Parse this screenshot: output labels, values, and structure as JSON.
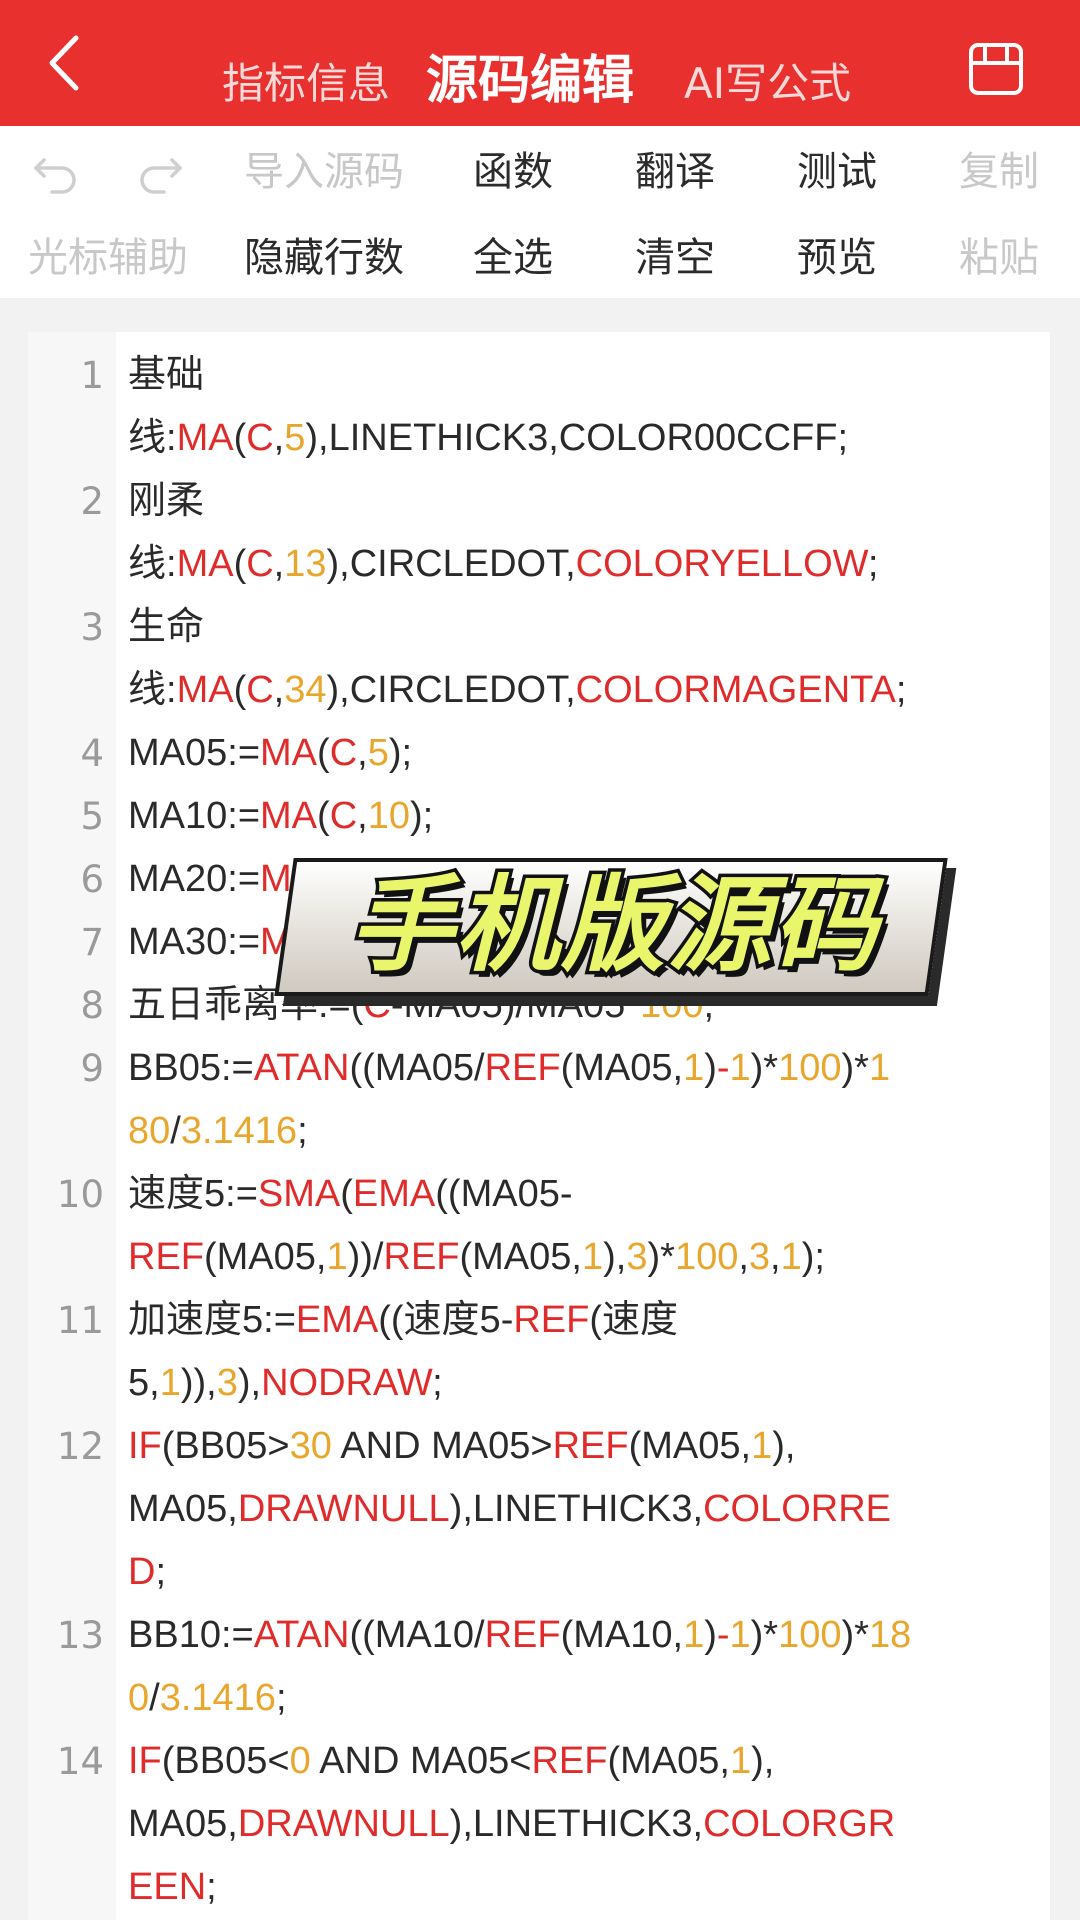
{
  "header": {
    "tabs": [
      {
        "label": "指标信息",
        "active": false
      },
      {
        "label": "源码编辑",
        "active": true
      },
      {
        "label": "AI写公式",
        "active": false
      }
    ],
    "back_icon": "chevron-left-icon",
    "save_icon": "save-icon",
    "color": "#e8312f"
  },
  "toolbar": {
    "row1": [
      {
        "icon": "undo-icon",
        "enabled": false
      },
      {
        "icon": "redo-icon",
        "enabled": false
      },
      {
        "label": "导入源码",
        "enabled": false
      },
      {
        "label": "函数",
        "enabled": true
      },
      {
        "label": "翻译",
        "enabled": true
      },
      {
        "label": "测试",
        "enabled": true
      },
      {
        "label": "复制",
        "enabled": false
      }
    ],
    "row2": [
      {
        "label": "光标辅助",
        "enabled": false
      },
      {
        "label": "隐藏行数",
        "enabled": true
      },
      {
        "label": "全选",
        "enabled": true
      },
      {
        "label": "清空",
        "enabled": true
      },
      {
        "label": "预览",
        "enabled": true
      },
      {
        "label": "粘贴",
        "enabled": false
      }
    ]
  },
  "colors": {
    "keyword": "#e02b2b",
    "number": "#e8a62c",
    "text": "#2a2a2a"
  },
  "code_lines": [
    {
      "num": "1",
      "rows": [
        [
          [
            "t",
            "基础"
          ]
        ],
        [
          [
            "t",
            "线:"
          ],
          [
            "k",
            "MA"
          ],
          [
            "t",
            "("
          ],
          [
            "k",
            "C"
          ],
          [
            "t",
            ","
          ],
          [
            "n",
            "5"
          ],
          [
            "t",
            "),LINETHICK3,COLOR00CCFF;"
          ]
        ]
      ]
    },
    {
      "num": "2",
      "rows": [
        [
          [
            "t",
            "刚柔"
          ]
        ],
        [
          [
            "t",
            "线:"
          ],
          [
            "k",
            "MA"
          ],
          [
            "t",
            "("
          ],
          [
            "k",
            "C"
          ],
          [
            "t",
            ","
          ],
          [
            "n",
            "13"
          ],
          [
            "t",
            "),CIRCLEDOT,"
          ],
          [
            "k",
            "COLORYELLOW"
          ],
          [
            "t",
            ";"
          ]
        ]
      ]
    },
    {
      "num": "3",
      "rows": [
        [
          [
            "t",
            "生命"
          ]
        ],
        [
          [
            "t",
            "线:"
          ],
          [
            "k",
            "MA"
          ],
          [
            "t",
            "("
          ],
          [
            "k",
            "C"
          ],
          [
            "t",
            ","
          ],
          [
            "n",
            "34"
          ],
          [
            "t",
            "),CIRCLEDOT,"
          ],
          [
            "k",
            "COLORMAGENTA"
          ],
          [
            "t",
            ";"
          ]
        ]
      ]
    },
    {
      "num": "4",
      "rows": [
        [
          [
            "t",
            "MA05:="
          ],
          [
            "k",
            "MA"
          ],
          [
            "t",
            "("
          ],
          [
            "k",
            "C"
          ],
          [
            "t",
            ","
          ],
          [
            "n",
            "5"
          ],
          [
            "t",
            ");"
          ]
        ]
      ]
    },
    {
      "num": "5",
      "rows": [
        [
          [
            "t",
            "MA10:="
          ],
          [
            "k",
            "MA"
          ],
          [
            "t",
            "("
          ],
          [
            "k",
            "C"
          ],
          [
            "t",
            ","
          ],
          [
            "n",
            "10"
          ],
          [
            "t",
            ");"
          ]
        ]
      ]
    },
    {
      "num": "6",
      "rows": [
        [
          [
            "t",
            "MA20:="
          ],
          [
            "k",
            "M"
          ]
        ]
      ]
    },
    {
      "num": "7",
      "rows": [
        [
          [
            "t",
            "MA30:="
          ],
          [
            "k",
            "M"
          ]
        ]
      ]
    },
    {
      "num": "8",
      "rows": [
        [
          [
            "t",
            "五日乖离率:=("
          ],
          [
            "k",
            "C"
          ],
          [
            "t",
            "-MA05)/MA05*"
          ],
          [
            "n",
            "100"
          ],
          [
            "t",
            ";"
          ]
        ]
      ]
    },
    {
      "num": "9",
      "rows": [
        [
          [
            "t",
            "BB05:="
          ],
          [
            "k",
            "ATAN"
          ],
          [
            "t",
            "((MA05/"
          ],
          [
            "k",
            "REF"
          ],
          [
            "t",
            "(MA05,"
          ],
          [
            "n",
            "1"
          ],
          [
            "t",
            ")"
          ],
          [
            "k",
            "-"
          ],
          [
            "n",
            "1"
          ],
          [
            "t",
            ")*"
          ],
          [
            "n",
            "100"
          ],
          [
            "t",
            ")*"
          ],
          [
            "n",
            "1"
          ]
        ],
        [
          [
            "n",
            "80"
          ],
          [
            "t",
            "/"
          ],
          [
            "n",
            "3.1416"
          ],
          [
            "t",
            ";"
          ]
        ]
      ]
    },
    {
      "num": "10",
      "rows": [
        [
          [
            "t",
            "速度5:="
          ],
          [
            "k",
            "SMA"
          ],
          [
            "t",
            "("
          ],
          [
            "k",
            "EMA"
          ],
          [
            "t",
            "((MA05-"
          ]
        ],
        [
          [
            "k",
            "REF"
          ],
          [
            "t",
            "(MA05,"
          ],
          [
            "n",
            "1"
          ],
          [
            "t",
            "))/"
          ],
          [
            "k",
            "REF"
          ],
          [
            "t",
            "(MA05,"
          ],
          [
            "n",
            "1"
          ],
          [
            "t",
            "),"
          ],
          [
            "n",
            "3"
          ],
          [
            "t",
            ")*"
          ],
          [
            "n",
            "100"
          ],
          [
            "t",
            ","
          ],
          [
            "n",
            "3"
          ],
          [
            "t",
            ","
          ],
          [
            "n",
            "1"
          ],
          [
            "t",
            ");"
          ]
        ]
      ]
    },
    {
      "num": "11",
      "rows": [
        [
          [
            "t",
            "加速度5:="
          ],
          [
            "k",
            "EMA"
          ],
          [
            "t",
            "((速度5-"
          ],
          [
            "k",
            "REF"
          ],
          [
            "t",
            "(速度"
          ]
        ],
        [
          [
            "t",
            "5,"
          ],
          [
            "n",
            "1"
          ],
          [
            "t",
            ")),"
          ],
          [
            "n",
            "3"
          ],
          [
            "t",
            "),"
          ],
          [
            "k",
            "NODRAW"
          ],
          [
            "t",
            ";"
          ]
        ]
      ]
    },
    {
      "num": "12",
      "rows": [
        [
          [
            "k",
            "IF"
          ],
          [
            "t",
            "(BB05>"
          ],
          [
            "n",
            "30"
          ],
          [
            "t",
            " AND MA05>"
          ],
          [
            "k",
            "REF"
          ],
          [
            "t",
            "(MA05,"
          ],
          [
            "n",
            "1"
          ],
          [
            "t",
            "),"
          ]
        ],
        [
          [
            "t",
            "MA05,"
          ],
          [
            "k",
            "DRAWNULL"
          ],
          [
            "t",
            "),LINETHICK3,"
          ],
          [
            "k",
            "COLORRE"
          ]
        ],
        [
          [
            "k",
            "D"
          ],
          [
            "t",
            ";"
          ]
        ]
      ]
    },
    {
      "num": "13",
      "rows": [
        [
          [
            "t",
            "BB10:="
          ],
          [
            "k",
            "ATAN"
          ],
          [
            "t",
            "((MA10/"
          ],
          [
            "k",
            "REF"
          ],
          [
            "t",
            "(MA10,"
          ],
          [
            "n",
            "1"
          ],
          [
            "t",
            ")"
          ],
          [
            "k",
            "-"
          ],
          [
            "n",
            "1"
          ],
          [
            "t",
            ")*"
          ],
          [
            "n",
            "100"
          ],
          [
            "t",
            ")*"
          ],
          [
            "n",
            "18"
          ]
        ],
        [
          [
            "n",
            "0"
          ],
          [
            "t",
            "/"
          ],
          [
            "n",
            "3.1416"
          ],
          [
            "t",
            ";"
          ]
        ]
      ]
    },
    {
      "num": "14",
      "rows": [
        [
          [
            "k",
            "IF"
          ],
          [
            "t",
            "(BB05<"
          ],
          [
            "n",
            "0"
          ],
          [
            "t",
            " AND MA05<"
          ],
          [
            "k",
            "REF"
          ],
          [
            "t",
            "(MA05,"
          ],
          [
            "n",
            "1"
          ],
          [
            "t",
            "),"
          ]
        ],
        [
          [
            "t",
            "MA05,"
          ],
          [
            "k",
            "DRAWNULL"
          ],
          [
            "t",
            "),LINETHICK3,"
          ],
          [
            "k",
            "COLORGR"
          ]
        ],
        [
          [
            "k",
            "EEN"
          ],
          [
            "t",
            ";"
          ]
        ]
      ]
    }
  ],
  "overlay": {
    "banner_text": "手机版源码"
  }
}
